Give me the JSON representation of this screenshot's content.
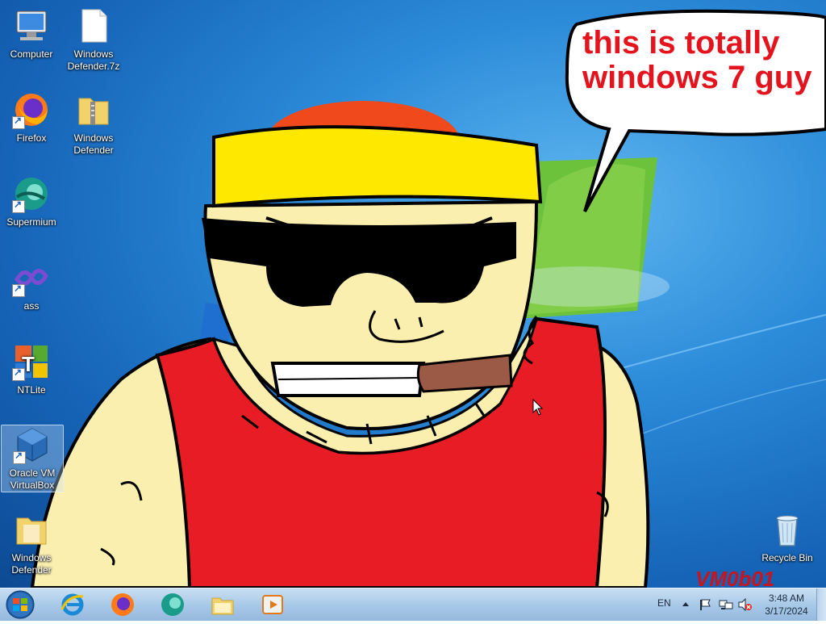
{
  "desktop_icons": [
    {
      "label": "Computer",
      "icon": "computer-icon"
    },
    {
      "label": "Windows Defender.7z",
      "icon": "archive-file-icon"
    },
    {
      "label": "Firefox",
      "icon": "firefox-icon"
    },
    {
      "label": "Windows Defender",
      "icon": "zip-folder-icon"
    },
    {
      "label": "Supermium",
      "icon": "supermium-icon"
    },
    {
      "label": "ass",
      "icon": "visual-studio-icon"
    },
    {
      "label": "NTLite",
      "icon": "ntlite-icon"
    },
    {
      "label": "Oracle VM VirtualBox",
      "icon": "virtualbox-icon"
    },
    {
      "label": "Windows Defender",
      "icon": "folder-icon"
    },
    {
      "label": "Recycle Bin",
      "icon": "recycle-bin-icon"
    }
  ],
  "wallpaper": {
    "bubble_text_line1": "this is totally",
    "bubble_text_line2": "windows 7 guy",
    "watermark": "VM0b01",
    "colors": {
      "background": "#1a78d0",
      "bubble_text": "#e3141e",
      "headband": "#ffe800",
      "shirt": "#e81c24",
      "skin": "#fbefaf"
    }
  },
  "taskbar": {
    "pinned": [
      "internet-explorer-icon",
      "firefox-icon",
      "supermium-icon",
      "file-explorer-icon",
      "media-player-icon"
    ],
    "language": "EN",
    "tray_icons": [
      "show-hidden-icons-arrow",
      "action-center-flag-icon",
      "network-icon",
      "volume-muted-icon"
    ],
    "time": "3:48 AM",
    "date": "3/17/2024"
  }
}
